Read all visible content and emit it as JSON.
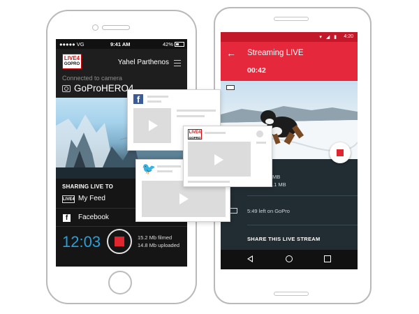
{
  "iphone": {
    "status": {
      "carrier": "●●●●● VG",
      "time": "9:41 AM",
      "battery": "42%"
    },
    "header": {
      "logo_line1": "LIVE4",
      "logo_line2": "GOPRO",
      "username": "Yahel Parthenos",
      "connected_text": "Connected to camera",
      "camera_name": "GoProHERO4"
    },
    "sharing": {
      "title": "SHARING LIVE TO",
      "feed_icon_text": "LIVE4",
      "feed_label": "My Feed",
      "facebook_label": "Facebook"
    },
    "recording": {
      "clock": "12:03",
      "filmed": "15.2 Mb filmed",
      "uploaded": "14.8 Mb uploaded"
    }
  },
  "android": {
    "status": {
      "icons": "▾ ◢ ▮",
      "time": "4:20"
    },
    "toolbar": {
      "title": "Streaming LIVE",
      "timer": "00:42"
    },
    "stats": {
      "mb1": "MB",
      "mb2": ".1 MB",
      "gopro_left": "5:49 left on GoPro"
    },
    "share_label": "SHARE THIS LIVE STREAM"
  },
  "cards": {
    "facebook_letter": "f",
    "live4_line1": "LIVE4",
    "live4_line2": "GOPRO",
    "twitter_glyph": "🐦"
  },
  "colors": {
    "accent_red": "#e5283b",
    "status_red": "#c2182a",
    "clock_blue": "#2a9fd8",
    "facebook_blue": "#3b5b98",
    "twitter_blue": "#2aa3ef"
  }
}
